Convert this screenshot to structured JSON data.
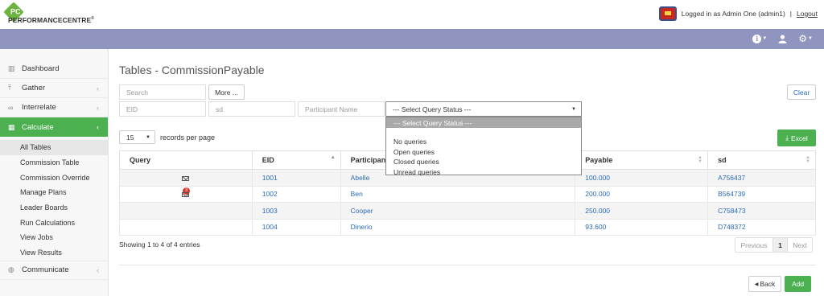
{
  "app": {
    "logo_mark": "PC",
    "logo_text": "PERFORMANCECENTRE",
    "logo_tm": "®"
  },
  "header": {
    "logged_in_text": "Logged in as Admin One (admin1)",
    "separator": "|",
    "logout": "Logout"
  },
  "nav": {
    "icons": [
      "info-icon",
      "user-icon",
      "gear-icon"
    ]
  },
  "sidebar": {
    "items": [
      {
        "label": "Dashboard",
        "icon": "bar-chart-icon"
      },
      {
        "label": "Gather",
        "icon": "upload-icon"
      },
      {
        "label": "Interrelate",
        "icon": "link-icon"
      },
      {
        "label": "Calculate",
        "icon": "table-icon"
      }
    ],
    "submenu": [
      "All Tables",
      "Commission Table",
      "Commission Override",
      "Manage Plans",
      "Leader Boards",
      "Run Calculations",
      "View Jobs",
      "View Results"
    ],
    "bottom": [
      {
        "label": "Communicate",
        "icon": "chat-icon"
      }
    ]
  },
  "main": {
    "title": "Tables - CommissionPayable",
    "filters": {
      "search_placeholder": "Search",
      "more_label": "More ...",
      "clear_label": "Clear",
      "eid_placeholder": "EID",
      "sd_placeholder": "sd",
      "participant_placeholder": "Participant Name",
      "query_status_value": "--- Select Query Status ---"
    },
    "records": {
      "value": "15",
      "label": "records per page"
    },
    "excel_label": "Excel",
    "table": {
      "headers": [
        "Query",
        "EID",
        "Participant",
        "Payable",
        "sd"
      ],
      "rows": [
        {
          "query_badge": "",
          "eid": "1001",
          "participant": "Abelle",
          "payable": "100.000",
          "sd": "A756437"
        },
        {
          "query_badge": "3",
          "eid": "1002",
          "participant": "Ben",
          "payable": "200.000",
          "sd": "B564739"
        },
        {
          "query_badge": "",
          "eid": "1003",
          "participant": "Cooper",
          "payable": "250.000",
          "sd": "C758473"
        },
        {
          "query_badge": "",
          "eid": "1004",
          "participant": "Dinerio",
          "payable": "93.600",
          "sd": "D748372"
        }
      ]
    },
    "showing": "Showing 1 to 4 of 4 entries",
    "pager": {
      "prev": "Previous",
      "current": "1",
      "next": "Next"
    },
    "back_label": "Back",
    "add_label": "Add"
  },
  "dropdown": {
    "options": [
      "--- Select Query Status ---",
      "",
      "No queries",
      "Open queries",
      "Closed queries",
      "Unread queries"
    ]
  }
}
